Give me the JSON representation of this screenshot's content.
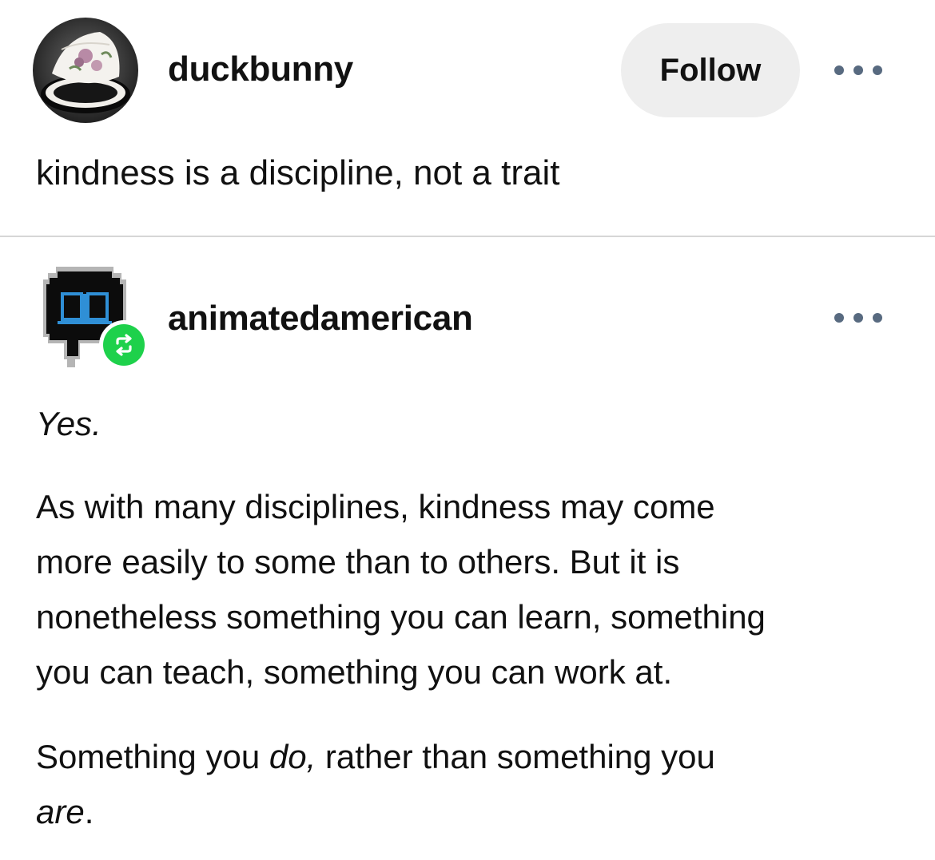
{
  "post1": {
    "username": "duckbunny",
    "follow_label": "Follow",
    "text": "kindness is a discipline, not a trait"
  },
  "post2": {
    "username": "animatedamerican",
    "yes": "Yes",
    "yes_period": ".",
    "para1_lines": [
      "As with many disciplines, kindness may come",
      "more easily to some than to others. But it is",
      "nonetheless something you can learn, something",
      "you can teach, something you can work at."
    ],
    "para2": {
      "part1": "Something you ",
      "em1": "do,",
      "part2": " rather than something you",
      "em2": "are",
      "end": "."
    }
  },
  "icons": {
    "more": "more-horizontal-icon",
    "reblog": "reblog-icon",
    "avatar1": "teacup-avatar",
    "avatar2": "book-speech-bubble-avatar"
  },
  "colors": {
    "reblog_green": "#1ed14b",
    "more_dots": "#586a80",
    "follow_bg": "#eeeeee",
    "divider": "#d6d6d6"
  }
}
